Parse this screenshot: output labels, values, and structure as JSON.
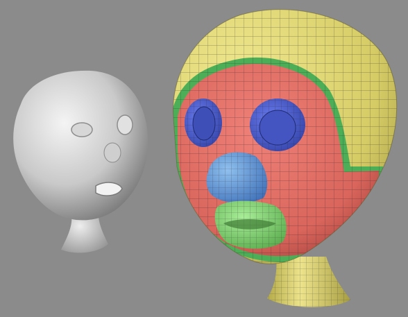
{
  "scene": {
    "background": "#8b8b8b",
    "objects": [
      {
        "name": "smooth-shaded-head",
        "material": "gray"
      },
      {
        "name": "quad-mesh-head",
        "material": "patch-colored"
      }
    ],
    "patch_colors": {
      "skull": "#d9cf6a",
      "face": "#dc6a62",
      "eye_sockets": "#4f5fcc",
      "nose": "#4f86c8",
      "mouth": "#7ccf6e",
      "border_strip": "#4caf57",
      "neck": "#d8cd68"
    }
  }
}
